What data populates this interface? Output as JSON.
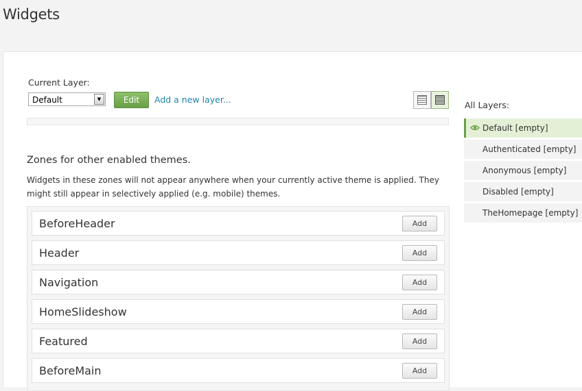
{
  "page": {
    "title": "Widgets"
  },
  "layer_controls": {
    "current_layer_label": "Current Layer:",
    "selected_layer": "Default",
    "edit_label": "Edit",
    "add_layer_link": "Add a new layer..."
  },
  "zones": {
    "heading": "Zones for other enabled themes.",
    "description": "Widgets in these zones will not appear anywhere when your currently active theme is applied. They might still appear in selectively applied (e.g. mobile) themes.",
    "items": [
      {
        "name": "BeforeHeader",
        "add_label": "Add"
      },
      {
        "name": "Header",
        "add_label": "Add"
      },
      {
        "name": "Navigation",
        "add_label": "Add"
      },
      {
        "name": "HomeSlideshow",
        "add_label": "Add"
      },
      {
        "name": "Featured",
        "add_label": "Add"
      },
      {
        "name": "BeforeMain",
        "add_label": "Add"
      }
    ]
  },
  "all_layers": {
    "title": "All Layers:",
    "items": [
      {
        "label": "Default [empty]",
        "active": true
      },
      {
        "label": "Authenticated [empty]",
        "active": false
      },
      {
        "label": "Anonymous [empty]",
        "active": false
      },
      {
        "label": "Disabled [empty]",
        "active": false
      },
      {
        "label": "TheHomepage [empty]",
        "active": false
      }
    ]
  },
  "colors": {
    "accent_green": "#6a9f47",
    "link_blue": "#1e82a8",
    "active_layer_bg": "#e4f0d6"
  },
  "icons": {
    "active_layer": "eye-icon",
    "select_arrow": "dropdown-arrow-icon",
    "view_toggle": [
      "list-view-icon",
      "compact-view-icon"
    ]
  }
}
